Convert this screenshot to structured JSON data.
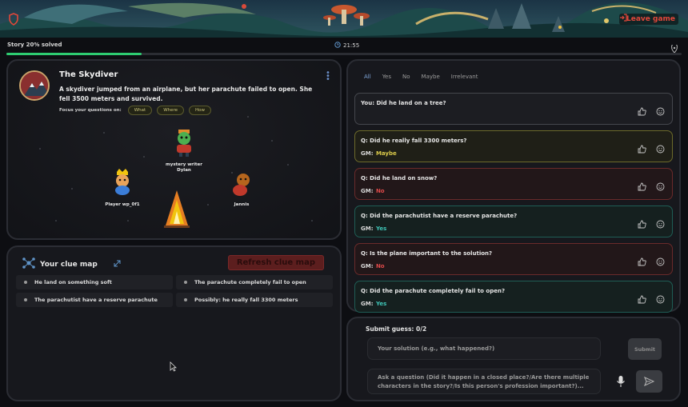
{
  "header": {
    "leave_label": "Leave game"
  },
  "progress": {
    "label": "Story 20% solved",
    "solved_fraction": 0.2,
    "timer": "21:55"
  },
  "story": {
    "title": "The Skydiver",
    "text": "A skydiver jumped from an airplane, but her parachute failed to open. She fell 3500 meters and survived.",
    "focus_label": "Focus your questions on:",
    "focus_chips": [
      "What",
      "Where",
      "How"
    ],
    "players": [
      {
        "name": "mystery writer Dylan",
        "color": "#4caf50"
      },
      {
        "name": "Player wp_0f1",
        "color": "#3b7dd8"
      },
      {
        "name": "Jannis",
        "color": "#c0392b"
      }
    ]
  },
  "clue_map": {
    "title": "Your clue map",
    "refresh_label": "Refresh clue map",
    "items": [
      "He land on something soft",
      "The parachute completely fail to open",
      "The parachutist have a reserve parachute",
      "Possibly: he really fall 3300 meters"
    ]
  },
  "qa": {
    "filters": [
      "All",
      "Yes",
      "No",
      "Maybe",
      "Irrelevant"
    ],
    "active_filter": "All",
    "entries": [
      {
        "question": "You: Did he land on a tree?",
        "gm_label": "",
        "answer": "",
        "tone": "neutral"
      },
      {
        "question": "Q: Did he really fall 3300 meters?",
        "gm_label": "GM:",
        "answer": "Maybe",
        "tone": "maybe"
      },
      {
        "question": "Q: Did he land on snow?",
        "gm_label": "GM:",
        "answer": "No",
        "tone": "no"
      },
      {
        "question": "Q: Did the parachutist have a reserve parachute?",
        "gm_label": "GM:",
        "answer": "Yes",
        "tone": "yes"
      },
      {
        "question": "Q: Is the plane important to the solution?",
        "gm_label": "GM:",
        "answer": "No",
        "tone": "no"
      },
      {
        "question": "Q: Did the parachute completely fail to open?",
        "gm_label": "GM:",
        "answer": "Yes",
        "tone": "yes"
      }
    ]
  },
  "input": {
    "guess_label": "Submit guess: 0/2",
    "solution_placeholder": "Your solution (e.g., what happened?)",
    "submit_label": "Submit",
    "question_placeholder": "Ask a question (Did it happen in a closed place?/Are there multiple characters in the story?/Is this person's profession important?)..."
  },
  "icons": [
    "shield-icon",
    "leave-icon",
    "clock-icon",
    "pin-icon",
    "kebab-icon",
    "network-icon",
    "expand-icon",
    "thumbs-up-icon",
    "smile-icon",
    "mic-icon",
    "send-icon"
  ]
}
